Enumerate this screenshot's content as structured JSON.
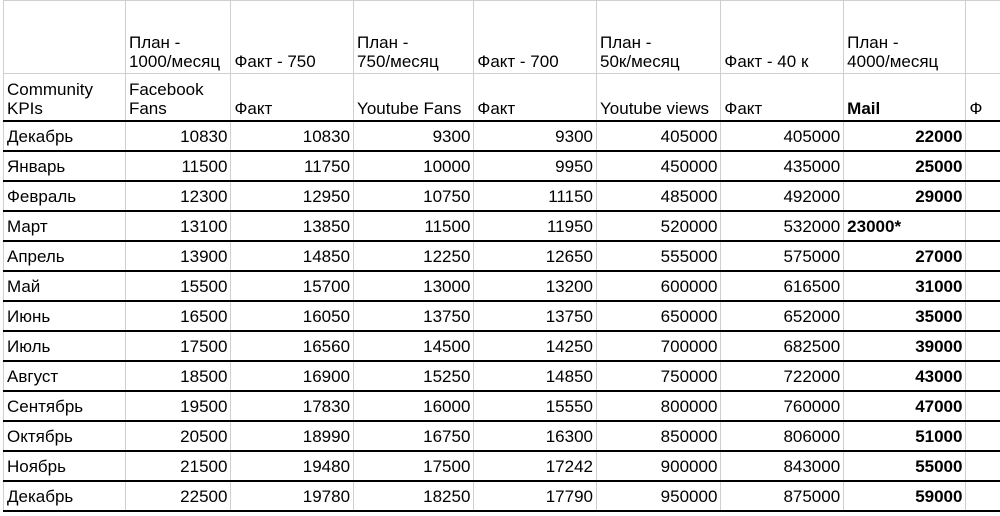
{
  "header_plan_row": [
    "",
    "План -\n1000/месяц",
    "Факт - 750",
    "План -\n750/месяц",
    "Факт - 700",
    "План -\n50к/месяц",
    "Факт - 40 к",
    "План -\n4000/месяц",
    ""
  ],
  "header_cols": [
    "Community\nKPIs",
    "Facebook\nFans",
    "Факт",
    "Youtube Fans",
    "Факт",
    "Youtube views",
    "Факт",
    "Mail",
    "Ф"
  ],
  "rows": [
    {
      "month": "Декабрь",
      "fb_plan": "10830",
      "fb_fact": "10830",
      "yt_plan": "9300",
      "yt_fact": "9300",
      "ytv_plan": "405000",
      "ytv_fact": "405000",
      "mail": "22000",
      "mail_fact": ""
    },
    {
      "month": "Январь",
      "fb_plan": "11500",
      "fb_fact": "11750",
      "yt_plan": "10000",
      "yt_fact": "9950",
      "ytv_plan": "450000",
      "ytv_fact": "435000",
      "mail": "25000",
      "mail_fact": ""
    },
    {
      "month": "Февраль",
      "fb_plan": "12300",
      "fb_fact": "12950",
      "yt_plan": "10750",
      "yt_fact": "11150",
      "ytv_plan": "485000",
      "ytv_fact": "492000",
      "mail": "29000",
      "mail_fact": ""
    },
    {
      "month": "Март",
      "fb_plan": "13100",
      "fb_fact": "13850",
      "yt_plan": "11500",
      "yt_fact": "11950",
      "ytv_plan": "520000",
      "ytv_fact": "532000",
      "mail": "23000*",
      "mail_fact": ""
    },
    {
      "month": "Апрель",
      "fb_plan": "13900",
      "fb_fact": "14850",
      "yt_plan": "12250",
      "yt_fact": "12650",
      "ytv_plan": "555000",
      "ytv_fact": "575000",
      "mail": "27000",
      "mail_fact": ""
    },
    {
      "month": "Май",
      "fb_plan": "15500",
      "fb_fact": "15700",
      "yt_plan": "13000",
      "yt_fact": "13200",
      "ytv_plan": "600000",
      "ytv_fact": "616500",
      "mail": "31000",
      "mail_fact": ""
    },
    {
      "month": "Июнь",
      "fb_plan": "16500",
      "fb_fact": "16050",
      "yt_plan": "13750",
      "yt_fact": "13750",
      "ytv_plan": "650000",
      "ytv_fact": "652000",
      "mail": "35000",
      "mail_fact": ""
    },
    {
      "month": "Июль",
      "fb_plan": "17500",
      "fb_fact": "16560",
      "yt_plan": "14500",
      "yt_fact": "14250",
      "ytv_plan": "700000",
      "ytv_fact": "682500",
      "mail": "39000",
      "mail_fact": ""
    },
    {
      "month": "Август",
      "fb_plan": "18500",
      "fb_fact": "16900",
      "yt_plan": "15250",
      "yt_fact": "14850",
      "ytv_plan": "750000",
      "ytv_fact": "722000",
      "mail": "43000",
      "mail_fact": ""
    },
    {
      "month": "Сентябрь",
      "fb_plan": "19500",
      "fb_fact": "17830",
      "yt_plan": "16000",
      "yt_fact": "15550",
      "ytv_plan": "800000",
      "ytv_fact": "760000",
      "mail": "47000",
      "mail_fact": ""
    },
    {
      "month": "Октябрь",
      "fb_plan": "20500",
      "fb_fact": "18990",
      "yt_plan": "16750",
      "yt_fact": "16300",
      "ytv_plan": "850000",
      "ytv_fact": "806000",
      "mail": "51000",
      "mail_fact": ""
    },
    {
      "month": "Ноябрь",
      "fb_plan": "21500",
      "fb_fact": "19480",
      "yt_plan": "17500",
      "yt_fact": "17242",
      "ytv_plan": "900000",
      "ytv_fact": "843000",
      "mail": "55000",
      "mail_fact": ""
    },
    {
      "month": "Декабрь",
      "fb_plan": "22500",
      "fb_fact": "19780",
      "yt_plan": "18250",
      "yt_fact": "17790",
      "ytv_plan": "950000",
      "ytv_fact": "875000",
      "mail": "59000",
      "mail_fact": ""
    }
  ]
}
